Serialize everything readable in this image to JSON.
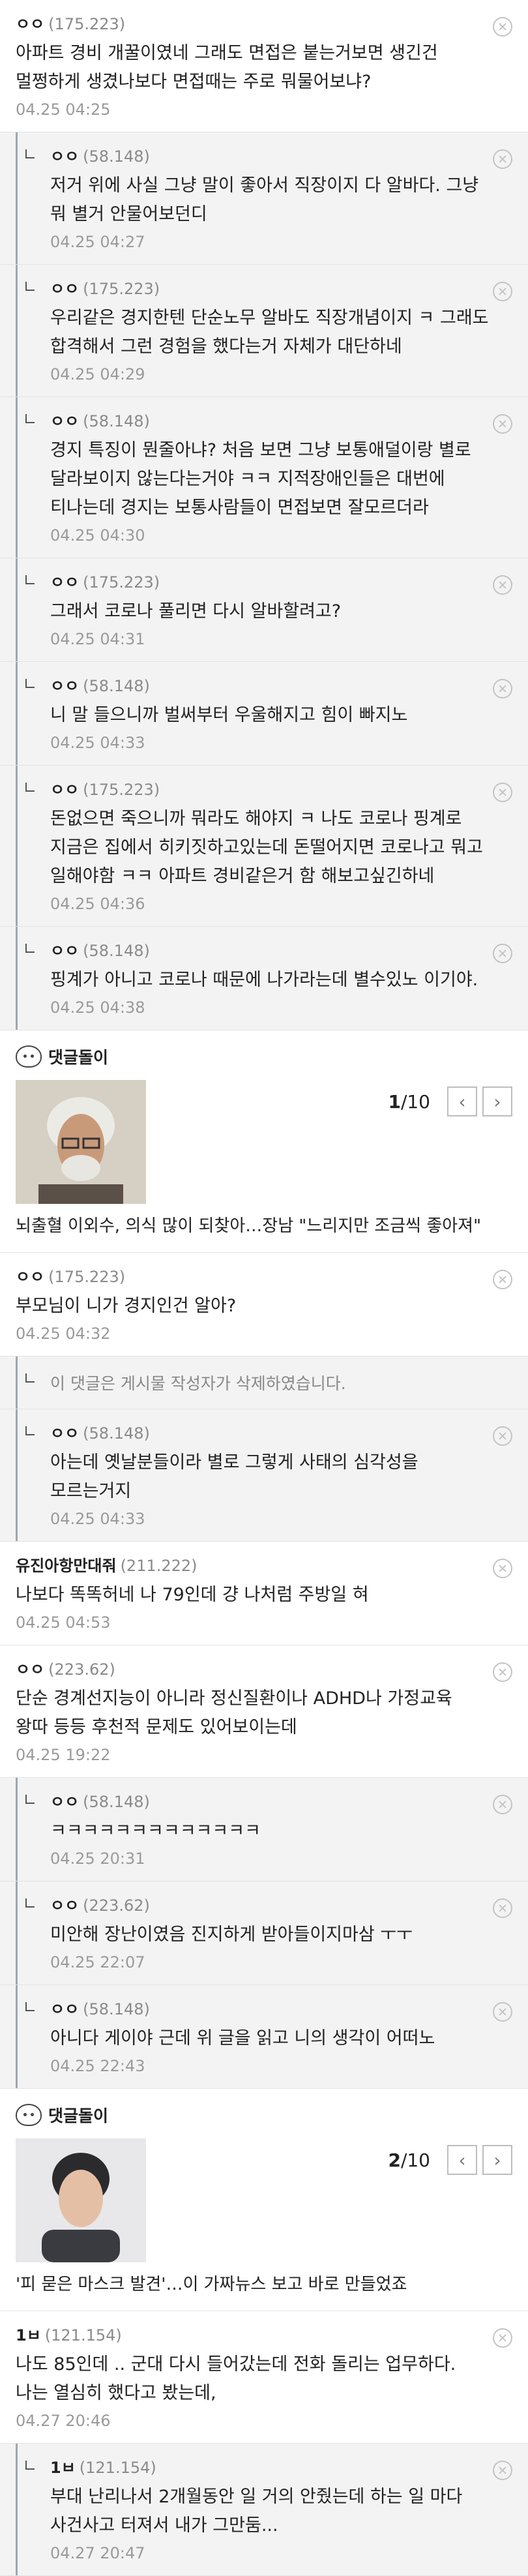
{
  "comments_top": [
    {
      "nick": "ㅇㅇ",
      "ip": "(175.223)",
      "text": "아파트 경비 개꿀이였네 그래도 면접은 붙는거보면 생긴건 멀쩡하게 생겼나보다 면접때는 주로 뭐물어보냐?",
      "date": "04.25 04:25",
      "reply": false
    },
    {
      "nick": "ㅇㅇ",
      "ip": "(58.148)",
      "text": "저거 위에 사실 그냥 말이 좋아서 직장이지 다 알바다. 그냥 뭐 별거 안물어보던디",
      "date": "04.25 04:27",
      "reply": true
    },
    {
      "nick": "ㅇㅇ",
      "ip": "(175.223)",
      "text": "우리같은 경지한텐 단순노무 알바도 직장개념이지 ㅋ 그래도 합격해서 그런 경험을 했다는거 자체가 대단하네",
      "date": "04.25 04:29",
      "reply": true
    },
    {
      "nick": "ㅇㅇ",
      "ip": "(58.148)",
      "text": "경지 특징이 뭔줄아냐? 처음 보면 그냥 보통애덜이랑 별로 달라보이지 않는다는거야 ㅋㅋ 지적장애인들은 대번에 티나는데 경지는 보통사람들이 면접보면 잘모르더라",
      "date": "04.25 04:30",
      "reply": true
    },
    {
      "nick": "ㅇㅇ",
      "ip": "(175.223)",
      "text": "그래서 코로나 풀리면 다시 알바할려고?",
      "date": "04.25 04:31",
      "reply": true
    },
    {
      "nick": "ㅇㅇ",
      "ip": "(58.148)",
      "text": "니 말 들으니까 벌써부터 우울해지고 힘이 빠지노",
      "date": "04.25 04:33",
      "reply": true
    },
    {
      "nick": "ㅇㅇ",
      "ip": "(175.223)",
      "text": "돈없으면 죽으니까 뭐라도 해야지 ㅋ 나도 코로나 핑계로 지금은 집에서 히키짓하고있는데 돈떨어지면 코로나고 뭐고 일해야함 ㅋㅋ 아파트 경비같은거 함 해보고싶긴하네",
      "date": "04.25 04:36",
      "reply": true
    },
    {
      "nick": "ㅇㅇ",
      "ip": "(58.148)",
      "text": "핑계가 아니고 코로나 때문에 나가라는데 별수있노 이기야.",
      "date": "04.25 04:38",
      "reply": true
    }
  ],
  "news1": {
    "bot": "댓글돌이",
    "page": "1",
    "total": "/10",
    "prev": "‹",
    "next": "›",
    "title": "뇌출혈 이외수, 의식 많이 되찾아…장남 \"느리지만 조금씩 좋아져\""
  },
  "comments_mid": [
    {
      "nick": "ㅇㅇ",
      "ip": "(175.223)",
      "text": "부모님이 니가 경지인건 알아?",
      "date": "04.25 04:32",
      "reply": false
    }
  ],
  "deleted_text": "이 댓글은 게시물 작성자가 삭제하였습니다.",
  "comments_mid2": [
    {
      "nick": "ㅇㅇ",
      "ip": "(58.148)",
      "text": "아는데 옛날분들이라 별로 그렇게 사태의 심각성을 모르는거지",
      "date": "04.25 04:33",
      "reply": true
    },
    {
      "nick": "유진아항만대줘",
      "ip": "(211.222)",
      "text": "나보다 똑똑허네 나 79인데 걍 나처럼 주방일 혀",
      "date": "04.25 04:53",
      "reply": false
    },
    {
      "nick": "ㅇㅇ",
      "ip": "(223.62)",
      "text": "단순 경계선지능이 아니라 정신질환이나 ADHD나 가정교육 왕따 등등 후천적 문제도 있어보이는데",
      "date": "04.25 19:22",
      "reply": false
    },
    {
      "nick": "ㅇㅇ",
      "ip": "(58.148)",
      "text": "ㅋㅋㅋㅋㅋㅋㅋㅋㅋㅋㅋㅋㅋ",
      "date": "04.25 20:31",
      "reply": true
    },
    {
      "nick": "ㅇㅇ",
      "ip": "(223.62)",
      "text": "미안해 장난이였음 진지하게 받아들이지마삼 ㅜㅜ",
      "date": "04.25 22:07",
      "reply": true
    },
    {
      "nick": "ㅇㅇ",
      "ip": "(58.148)",
      "text": "아니다 게이야 근데 위 글을 읽고 니의 생각이 어떠노",
      "date": "04.25 22:43",
      "reply": true
    }
  ],
  "news2": {
    "bot": "댓글돌이",
    "page": "2",
    "total": "/10",
    "prev": "‹",
    "next": "›",
    "title": "'피 묻은 마스크 발견'…이 가짜뉴스 보고 바로 만들었죠"
  },
  "comments_bottom": [
    {
      "nick": "1ㅂ",
      "ip": "(121.154)",
      "text": "나도 85인데 .. 군대 다시 들어갔는데 전화 돌리는 업무하다. 나는 열심히 했다고 봤는데,",
      "date": "04.27 20:46",
      "reply": false
    },
    {
      "nick": "1ㅂ",
      "ip": "(121.154)",
      "text": "부대 난리나서 2개월동안 일 거의 안줬는데 하는 일 마다 사건사고 터져서 내가 그만둠...",
      "date": "04.27 20:47",
      "reply": true
    }
  ]
}
